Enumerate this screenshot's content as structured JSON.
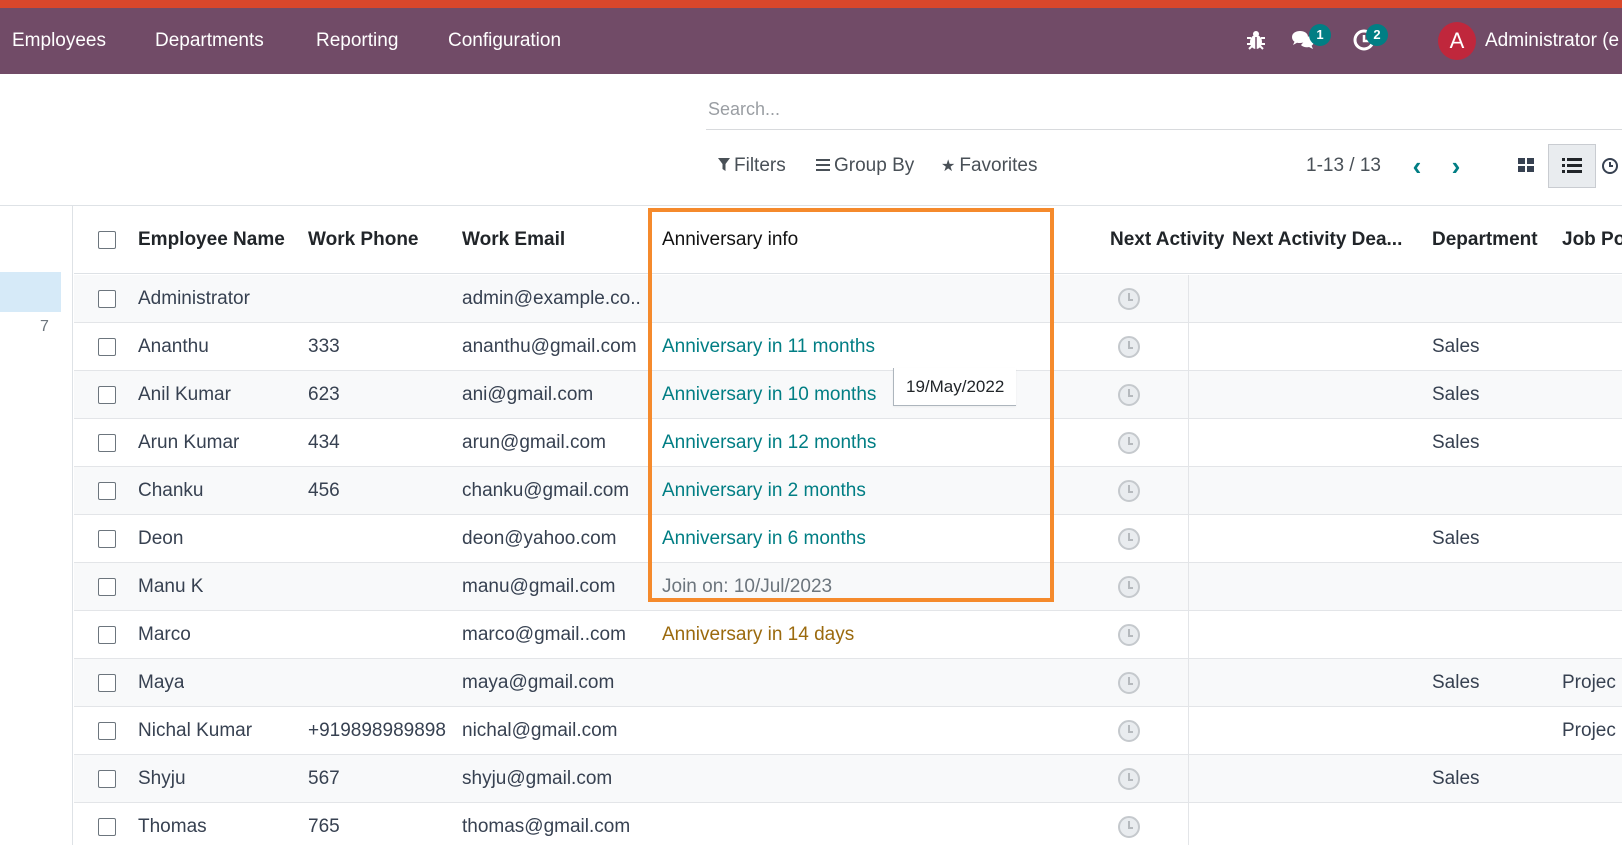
{
  "colors": {
    "navbar": "#714b67",
    "accent_strip": "#d9472b",
    "link_teal": "#017e84",
    "highlight_orange": "#f58a2c",
    "soon_amber": "#9b6a0e"
  },
  "navbar": {
    "items": [
      "Employees",
      "Departments",
      "Reporting",
      "Configuration"
    ],
    "icons": [
      "bug-icon",
      "chat-icon",
      "activity-clock-icon"
    ],
    "chat_badge": "1",
    "activity_badge": "2",
    "avatar_letter": "A",
    "user_label": "Administrator (e"
  },
  "search": {
    "placeholder": "Search..."
  },
  "control_panel": {
    "filters": "Filters",
    "group_by": "Group By",
    "favorites": "Favorites",
    "pager": "1-13 / 13"
  },
  "sidebar": {
    "count": "7"
  },
  "table": {
    "headers": {
      "name": "Employee Name",
      "phone": "Work Phone",
      "email": "Work Email",
      "anniversary": "Anniversary info",
      "next_activity": "Next Activity",
      "deadline": "Next Activity Dea...",
      "department": "Department",
      "job": "Job Po"
    },
    "rows": [
      {
        "name": "Administrator",
        "phone": "",
        "email": "admin@example.co...",
        "anniversary": "",
        "department": "",
        "job": ""
      },
      {
        "name": "Ananthu",
        "phone": "333",
        "email": "ananthu@gmail.com",
        "anniversary": "Anniversary in 11 months",
        "department": "Sales",
        "job": ""
      },
      {
        "name": "Anil Kumar",
        "phone": "623",
        "email": "ani@gmail.com",
        "anniversary": "Anniversary in 10 months",
        "department": "Sales",
        "job": ""
      },
      {
        "name": "Arun Kumar",
        "phone": "434",
        "email": "arun@gmail.com",
        "anniversary": "Anniversary in 12 months",
        "department": "Sales",
        "job": ""
      },
      {
        "name": "Chanku",
        "phone": "456",
        "email": "chanku@gmail.com",
        "anniversary": "Anniversary in 2 months",
        "department": "",
        "job": ""
      },
      {
        "name": "Deon",
        "phone": "",
        "email": "deon@yahoo.com",
        "anniversary": "Anniversary in 6 months",
        "department": "Sales",
        "job": ""
      },
      {
        "name": "Manu K",
        "phone": "",
        "email": "manu@gmail.com",
        "anniversary": "Join on: 10/Jul/2023",
        "department": "",
        "job": ""
      },
      {
        "name": "Marco",
        "phone": "",
        "email": "marco@gmail..com",
        "anniversary": "Anniversary in 14 days",
        "department": "",
        "job": ""
      },
      {
        "name": "Maya",
        "phone": "",
        "email": "maya@gmail.com",
        "anniversary": "",
        "department": "Sales",
        "job": "Projec"
      },
      {
        "name": "Nichal Kumar",
        "phone": "+919898989898",
        "email": "nichal@gmail.com",
        "anniversary": "",
        "department": "",
        "job": "Projec"
      },
      {
        "name": "Shyju",
        "phone": "567",
        "email": "shyju@gmail.com",
        "anniversary": "",
        "department": "Sales",
        "job": ""
      },
      {
        "name": "Thomas",
        "phone": "765",
        "email": "thomas@gmail.com",
        "anniversary": "",
        "department": "",
        "job": ""
      }
    ]
  },
  "tooltip": {
    "text": "19/May/2022"
  }
}
